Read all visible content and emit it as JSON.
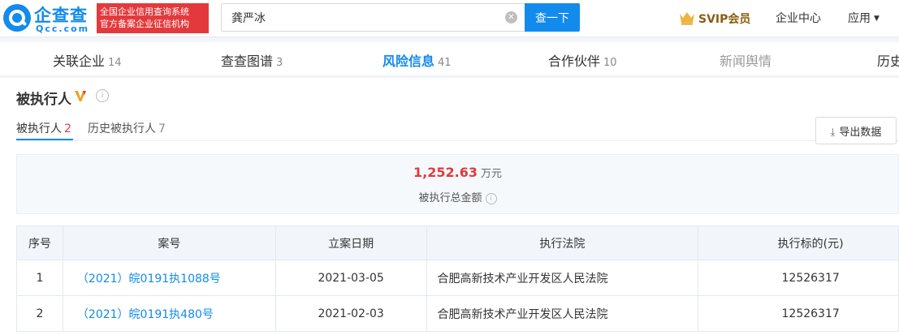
{
  "header": {
    "logo_name": "企查查",
    "logo_domain": "Qcc.com",
    "slogan_line1": "全国企业信用查询系统",
    "slogan_line2": "官方备案企业征信机构",
    "search_value": "龚严冰",
    "search_button": "查一下",
    "svip_label": "SVIP会员",
    "nav_enterprise_center": "企业中心",
    "nav_apps": "应用"
  },
  "tabs": [
    {
      "label": "关联企业",
      "count": "14"
    },
    {
      "label": "查查图谱",
      "count": "3"
    },
    {
      "label": "风险信息",
      "count": "41"
    },
    {
      "label": "合作伙伴",
      "count": "10"
    },
    {
      "label": "新闻舆情",
      "count": ""
    },
    {
      "label": "历史",
      "count": ""
    }
  ],
  "section": {
    "title": "被执行人",
    "subtabs": [
      {
        "label": "被执行人",
        "count": "2"
      },
      {
        "label": "历史被执行人",
        "count": "7"
      }
    ],
    "export_button": "导出数据",
    "summary_value": "1,252.63",
    "summary_unit": "万元",
    "summary_label": "被执行总金额"
  },
  "table": {
    "headers": [
      "序号",
      "案号",
      "立案日期",
      "执行法院",
      "执行标的(元)"
    ],
    "rows": [
      {
        "idx": "1",
        "case_no": "（2021）皖0191执1088号",
        "date": "2021-03-05",
        "court": "合肥高新技术产业开发区人民法院",
        "amount": "12526317"
      },
      {
        "idx": "2",
        "case_no": "（2021）皖0191执480号",
        "date": "2021-02-03",
        "court": "合肥高新技术产业开发区人民法院",
        "amount": "12526317"
      }
    ]
  },
  "colors": {
    "brand": "#128bed",
    "alert": "#e4393c",
    "vip_gold": "#8b5d0e"
  },
  "icons": [
    "logo-icon",
    "clear-icon",
    "crown-icon",
    "chevron-down-icon",
    "vip-icon",
    "info-icon",
    "download-icon"
  ]
}
